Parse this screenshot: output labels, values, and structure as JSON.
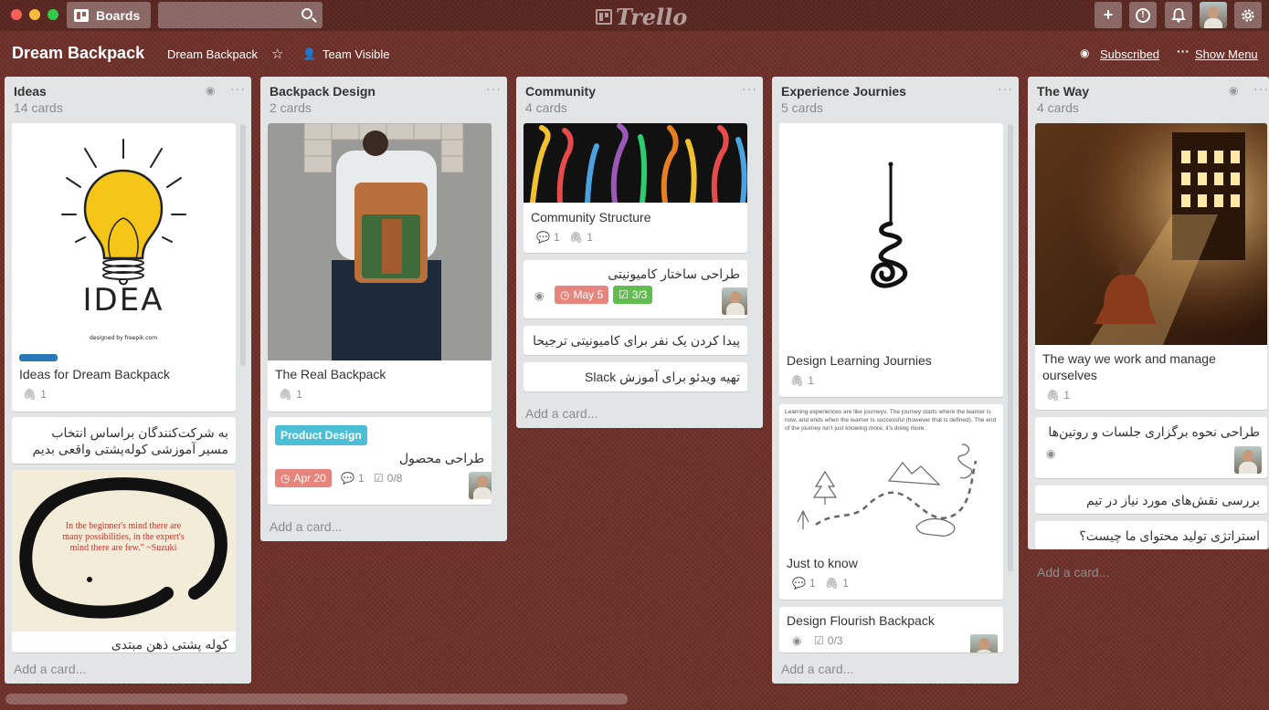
{
  "topbar": {
    "boards_label": "Boards",
    "search_placeholder": "",
    "logo_text": "Trello",
    "add_icon": "plus-icon",
    "info_icon": "info-icon",
    "notifications_icon": "bell-icon",
    "settings_icon": "gear-icon"
  },
  "board": {
    "title": "Dream Backpack",
    "name_button": "Dream Backpack",
    "visibility": "Team Visible",
    "subscribed": "Subscribed",
    "show_menu": "Show Menu"
  },
  "lists": [
    {
      "title": "Ideas",
      "count": "14 cards",
      "add_card": "Add a card...",
      "cards": [
        {
          "title": "Ideas for Dream Backpack",
          "label_color": "#2979b9",
          "attachments": "1",
          "cover_text": "IDEA",
          "cover_credit": "designed by freepik.com"
        },
        {
          "title": "به شرکت‌کنندگان براساس انتخاب مسیر آموزشی کوله‌پشتی واقعی بدیم"
        },
        {
          "title": "کوله پشتی ذهن مبتدی",
          "cover_quote": "In the beginner's mind there are many possibilities, in the expert's mind there are few.\" ~Suzuki"
        }
      ]
    },
    {
      "title": "Backpack Design",
      "count": "2 cards",
      "add_card": "Add a card...",
      "cards": [
        {
          "title": "The Real Backpack",
          "attachments": "1"
        },
        {
          "title": "طراحی محصول",
          "label": "Product Design",
          "label_color": "#4bbfd6",
          "due": "Apr 20",
          "due_color": "#e7857c",
          "comments": "1",
          "checklist": "0/8"
        }
      ]
    },
    {
      "title": "Community",
      "count": "4 cards",
      "add_card": "Add a card...",
      "cards": [
        {
          "title": "Community Structure",
          "comments": "1",
          "attachments": "1"
        },
        {
          "title": "طراحی ساختار کامیونیتی",
          "due": "May 5",
          "due_color": "#e7857c",
          "checklist": "3/3",
          "checklist_color": "#61bd4f"
        },
        {
          "title": "پیدا کردن یک نفر برای کامیونیتی ترجیحا"
        },
        {
          "title": "تهیه ویدئو برای آموزش Slack"
        }
      ]
    },
    {
      "title": "Experience Journies",
      "count": "5 cards",
      "add_card": "Add a card...",
      "cards": [
        {
          "title": "Design Learning Journies",
          "attachments": "1"
        },
        {
          "title": "Just to know",
          "comments": "1",
          "attachments": "1",
          "cover_text": "Learning experiences are like journeys. The journey starts where the learner is now, and ends when the learner is successful (however that is defined). The end of the journey isn't just knowing more, it's doing more."
        },
        {
          "title": "Design Flourish Backpack",
          "checklist": "0/3"
        }
      ]
    },
    {
      "title": "The Way",
      "count": "4 cards",
      "add_card": "Add a card...",
      "cards": [
        {
          "title": "The way we work and manage ourselves",
          "attachments": "1"
        },
        {
          "title": "طراحی نحوه برگزاری جلسات و روتین‌ها"
        },
        {
          "title": "بررسی نقش‌های مورد نیاز در تیم"
        },
        {
          "title": "استراتژی تولید محتوای ما چیست؟"
        }
      ]
    }
  ]
}
